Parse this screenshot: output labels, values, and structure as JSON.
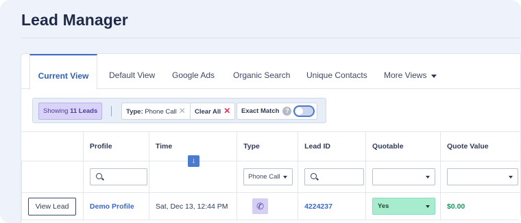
{
  "page": {
    "title": "Lead Manager"
  },
  "tabs": [
    {
      "label": "Current View"
    },
    {
      "label": "Default View"
    },
    {
      "label": "Google Ads"
    },
    {
      "label": "Organic Search"
    },
    {
      "label": "Unique Contacts"
    },
    {
      "label": "More Views"
    }
  ],
  "filters": {
    "showing_prefix": "Showing",
    "showing_count": "11 Leads",
    "type_label": "Type:",
    "type_value": "Phone Call",
    "clear_all": "Clear All",
    "exact_match": "Exact Match",
    "exact_match_on": false
  },
  "table": {
    "columns": [
      "",
      "Profile",
      "Time",
      "Type",
      "Lead ID",
      "Quotable",
      "Quote Value"
    ],
    "filter_row": {
      "type_select": "Phone Call",
      "quotable_select": "",
      "quote_value_select": ""
    },
    "rows": [
      {
        "action": "View Lead",
        "profile": "Demo Profile",
        "time": "Sat, Dec 13, 12:44 PM",
        "type_icon": "phone-icon",
        "lead_id": "4224237",
        "quotable": "Yes",
        "quote_value": "$0.00"
      }
    ]
  },
  "colors": {
    "accent": "#3b68c4",
    "showing_bg": "#d9d3f7",
    "quotable_yes_bg": "#a8ecd0",
    "money": "#17995f"
  }
}
